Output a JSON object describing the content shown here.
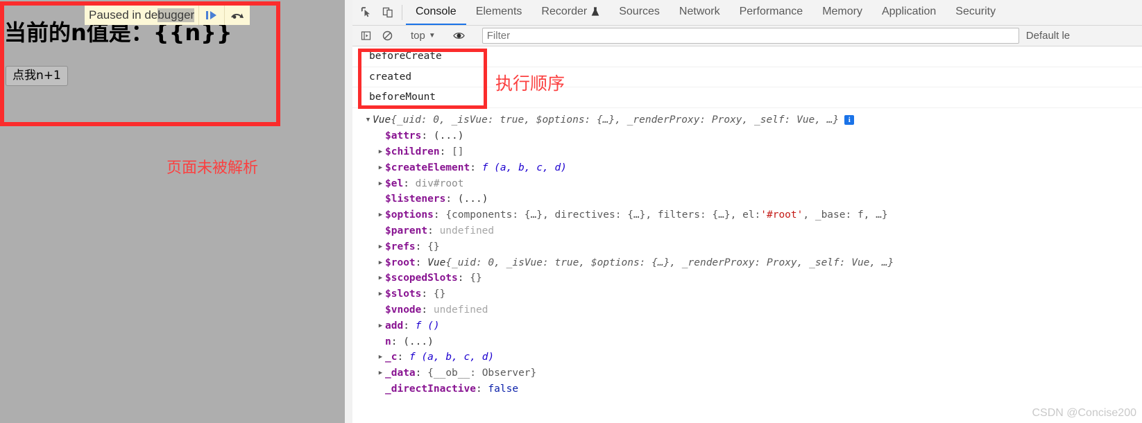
{
  "page": {
    "headline": "当前的n值是：{{n}}",
    "button_label": "点我n+1",
    "annotation": "页面未被解析",
    "debugger_overlay": {
      "text_normal": "Paused in de",
      "text_selected": "bugger",
      "resume_icon": "resume-script-icon",
      "step_over_icon": "step-over-icon"
    },
    "accent_red": "#fb2c2c",
    "annotation_red": "#fb4040",
    "background": "#aeaeae"
  },
  "devtools": {
    "toolbar_icons": [
      {
        "name": "inspect-element-icon"
      },
      {
        "name": "device-toolbar-icon"
      }
    ],
    "tabs": [
      {
        "label": "Console",
        "active": true,
        "badge": null
      },
      {
        "label": "Elements",
        "active": false,
        "badge": null
      },
      {
        "label": "Recorder",
        "active": false,
        "badge": "flask-icon"
      },
      {
        "label": "Sources",
        "active": false,
        "badge": null
      },
      {
        "label": "Network",
        "active": false,
        "badge": null
      },
      {
        "label": "Performance",
        "active": false,
        "badge": null
      },
      {
        "label": "Memory",
        "active": false,
        "badge": null
      },
      {
        "label": "Application",
        "active": false,
        "badge": null
      },
      {
        "label": "Security",
        "active": false,
        "badge": null
      }
    ],
    "filterbar": {
      "sidebar_icon": "console-sidebar-icon",
      "clear_icon": "clear-console-icon",
      "context": "top",
      "context_caret": "▼",
      "eye_icon": "live-expression-eye-icon",
      "filter_value": "",
      "filter_placeholder": "Filter",
      "level_label": "Default le"
    },
    "accent_blue": "#1a73e8"
  },
  "console": {
    "annotation": "执行顺序",
    "logs": [
      {
        "text": "beforeCreate"
      },
      {
        "text": "created"
      },
      {
        "text": "beforeMount"
      }
    ],
    "object_header": {
      "triangle": "▼",
      "class": "Vue",
      "preview": " {_uid: 0, _isVue: true, $options: {…}, _renderProxy: Proxy, _self: Vue, …}",
      "info_badge": "i"
    },
    "properties": [
      {
        "arrow": "",
        "key": "$attrs",
        "sep": ": ",
        "value": "(...)",
        "vclass": "val-dots"
      },
      {
        "arrow": "▶",
        "key": "$children",
        "sep": ": ",
        "value": "[]",
        "vclass": "val-obj"
      },
      {
        "arrow": "▶",
        "key": "$createElement",
        "sep": ": ",
        "value": "f (a, b, c, d)",
        "vclass": "val-fn"
      },
      {
        "arrow": "▶",
        "key": "$el",
        "sep": ": ",
        "value": "div#root",
        "vclass": "val-dom"
      },
      {
        "arrow": "",
        "key": "$listeners",
        "sep": ": ",
        "value": "(...)",
        "vclass": "val-dots"
      },
      {
        "arrow": "▶",
        "key": "$options",
        "sep": ": ",
        "value": "{components: {…}, directives: {…}, filters: {…}, el: '#root', _base: f, …}",
        "vclass": "val-obj",
        "special": "options"
      },
      {
        "arrow": "",
        "key": "$parent",
        "sep": ": ",
        "value": "undefined",
        "vclass": "val-undef"
      },
      {
        "arrow": "▶",
        "key": "$refs",
        "sep": ": ",
        "value": "{}",
        "vclass": "val-obj"
      },
      {
        "arrow": "▶",
        "key": "$root",
        "sep": ": ",
        "value": "Vue {_uid: 0, _isVue: true, $options: {…}, _renderProxy: Proxy, _self: Vue, …}",
        "vclass": "val-obj",
        "special": "root"
      },
      {
        "arrow": "▶",
        "key": "$scopedSlots",
        "sep": ": ",
        "value": "{}",
        "vclass": "val-obj"
      },
      {
        "arrow": "▶",
        "key": "$slots",
        "sep": ": ",
        "value": "{}",
        "vclass": "val-obj"
      },
      {
        "arrow": "",
        "key": "$vnode",
        "sep": ": ",
        "value": "undefined",
        "vclass": "val-undef"
      },
      {
        "arrow": "▶",
        "key": "add",
        "sep": ": ",
        "value": "f ()",
        "vclass": "val-fn"
      },
      {
        "arrow": "",
        "key": "n",
        "sep": ": ",
        "value": "(...)",
        "vclass": "val-dots"
      },
      {
        "arrow": "▶",
        "key": "_c",
        "sep": ": ",
        "value": "f (a, b, c, d)",
        "vclass": "val-fn"
      },
      {
        "arrow": "▶",
        "key": "_data",
        "sep": ": ",
        "value": "{__ob__: Observer}",
        "vclass": "val-obj"
      },
      {
        "arrow": "",
        "key": "_directInactive",
        "sep": ": ",
        "value": "false",
        "vclass": "val-bool"
      }
    ]
  },
  "watermark": "CSDN @Concise200"
}
